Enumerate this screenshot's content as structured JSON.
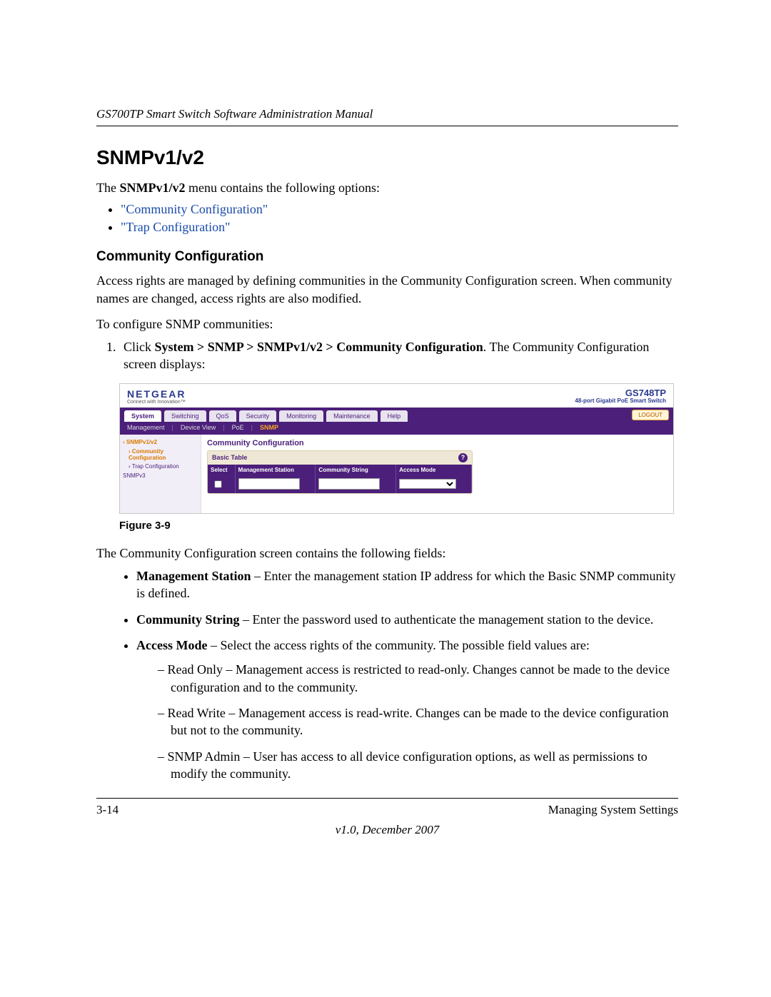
{
  "header": {
    "running": "GS700TP Smart Switch Software Administration Manual"
  },
  "title": "SNMPv1/v2",
  "intro_pre": "The ",
  "intro_bold": "SNMPv1/v2",
  "intro_post": " menu contains the following options:",
  "links": {
    "community": "\"Community Configuration\"",
    "trap": "\"Trap Configuration\""
  },
  "subhead": "Community Configuration",
  "para_access": "Access rights are managed by defining communities in the Community Configuration screen. When community names are changed, access rights are also modified.",
  "para_to_configure": "To configure SNMP communities:",
  "step1_pre": "Click ",
  "step1_bold": "System > SNMP > SNMPv1/v2 > Community Configuration",
  "step1_post": ". The Community Configuration screen displays:",
  "figure": {
    "caption": "Figure 3-9",
    "brand": "NETGEAR",
    "brand_tag": "Connect with Innovation™",
    "product_model": "GS748TP",
    "product_desc": "48-port Gigabit PoE Smart Switch",
    "tabs": [
      "System",
      "Switching",
      "QoS",
      "Security",
      "Monitoring",
      "Maintenance",
      "Help"
    ],
    "logout": "LOGOUT",
    "subtabs": [
      "Management",
      "Device View",
      "PoE",
      "SNMP"
    ],
    "side": {
      "group1": "SNMPv1/v2",
      "sub_sel": "Community Configuration",
      "sub2": "Trap Configuration",
      "group2": "SNMPv3"
    },
    "panel_title": "Community Configuration",
    "basic_table": "Basic Table",
    "th_select": "Select",
    "th_ms": "Management Station",
    "th_cs": "Community String",
    "th_am": "Access Mode"
  },
  "after_fig": "The Community Configuration screen contains the following fields:",
  "fields": {
    "ms_label": "Management Station",
    "ms_text": " – Enter the management station IP address for which the Basic SNMP community is defined.",
    "cs_label": "Community String",
    "cs_text": " – Enter the password used to authenticate the management station to the device.",
    "am_label": "Access Mode",
    "am_text": " – Select the access rights of the community. The possible field values are:",
    "ro": "Read Only – Management access is restricted to read-only. Changes cannot be made to the device configuration and to the community.",
    "rw": "Read Write – Management access is read-write. Changes can be made to the device configuration but not to the community.",
    "admin": "SNMP Admin – User has access to all device configuration options, as well as permissions to modify the community."
  },
  "footer": {
    "page": "3-14",
    "section": "Managing System Settings",
    "version": "v1.0, December 2007"
  }
}
